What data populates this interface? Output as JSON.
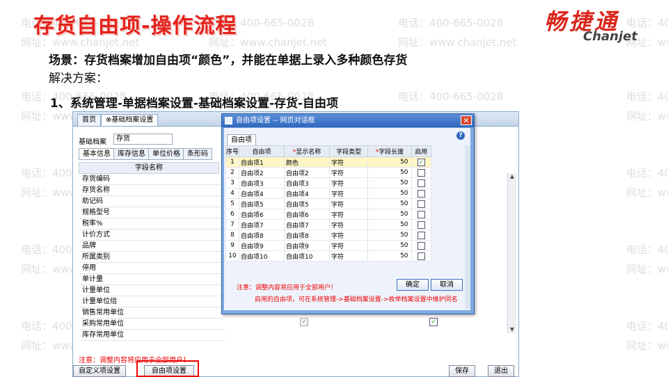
{
  "slide": {
    "title": "存货自由项-操作流程",
    "logo_cn": "畅捷通",
    "logo_en": "Chanjet",
    "scene": "场景：存货档案增加自由项“颜色”，并能在单据上录入多种颜色存货",
    "solution": "解决方案：",
    "step1": "1、系统管理-单据档案设置-基础档案设置-存货-自由项",
    "watermark_phone": "电话：400-665-0028",
    "watermark_site": "网址：www.chanjet.net",
    "accent_color": "#e3221b"
  },
  "main_window": {
    "tabs": [
      "首页",
      "⊗基础档案设置"
    ],
    "archive_label": "基础档案",
    "archive_value": "存货",
    "subtabs": [
      "基本信息",
      "库存信息",
      "单位价格",
      "条形码"
    ],
    "fields_header": "字段名称",
    "fields": [
      "存货编码",
      "存货名称",
      "助记码",
      "规格型号",
      "税率%",
      "计价方式",
      "品牌",
      "所属类别",
      "停用",
      "单计量",
      "计量单位",
      "计量单位组",
      "销售常用单位",
      "采购常用单位",
      "库存常用单位"
    ],
    "note": "注意：调整内容将应用于全部用户！",
    "buttons": {
      "custom": "自定义项设置",
      "free": "自由项设置",
      "save": "保存",
      "exit": "退出"
    }
  },
  "dialog": {
    "title": "自由项设置 -- 网页对话框",
    "tab": "自由项",
    "help": "?",
    "columns": [
      "序号",
      "自由项",
      "*显示名称",
      "字段类型",
      "*字段长度",
      "启用"
    ],
    "rows": [
      {
        "no": "1",
        "item": "自由项1",
        "display": "颜色",
        "type": "字符",
        "length": "50",
        "enabled": true
      },
      {
        "no": "2",
        "item": "自由项2",
        "display": "自由项2",
        "type": "字符",
        "length": "50",
        "enabled": false
      },
      {
        "no": "3",
        "item": "自由项3",
        "display": "自由项3",
        "type": "字符",
        "length": "50",
        "enabled": false
      },
      {
        "no": "4",
        "item": "自由项4",
        "display": "自由项4",
        "type": "字符",
        "length": "50",
        "enabled": false
      },
      {
        "no": "5",
        "item": "自由项5",
        "display": "自由项5",
        "type": "字符",
        "length": "50",
        "enabled": false
      },
      {
        "no": "6",
        "item": "自由项6",
        "display": "自由项6",
        "type": "字符",
        "length": "50",
        "enabled": false
      },
      {
        "no": "7",
        "item": "自由项7",
        "display": "自由项7",
        "type": "字符",
        "length": "50",
        "enabled": false
      },
      {
        "no": "8",
        "item": "自由项8",
        "display": "自由项8",
        "type": "字符",
        "length": "50",
        "enabled": false
      },
      {
        "no": "9",
        "item": "自由项9",
        "display": "自由项9",
        "type": "字符",
        "length": "50",
        "enabled": false
      },
      {
        "no": "10",
        "item": "自由项10",
        "display": "自由项10",
        "type": "字符",
        "length": "50",
        "enabled": false
      }
    ],
    "note1": "注意：调整内容将应用于全部用户！",
    "note2": "启用的自由项，可在系统管理->基础档案设置->枚举档案设置中维护同名",
    "ok": "确定",
    "cancel": "取消"
  }
}
